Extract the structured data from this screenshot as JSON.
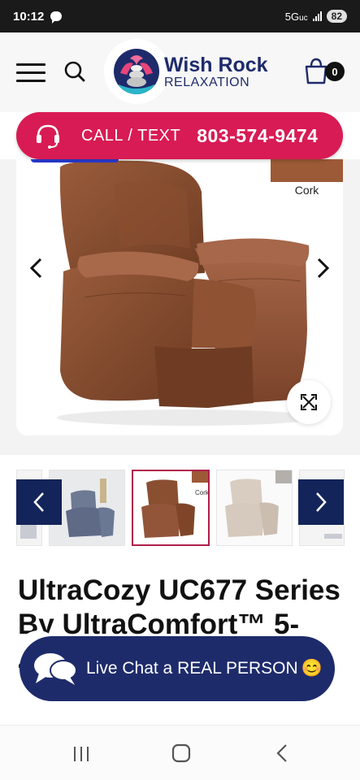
{
  "status_bar": {
    "time": "10:12",
    "network": "5G",
    "network_sub": "uc",
    "battery": "82"
  },
  "header": {
    "logo_line1": "Wish Rock",
    "logo_line2": "RELAXATION",
    "cart_count": "0"
  },
  "call_banner": {
    "label": "CALL / TEXT",
    "number": "803-574-9474"
  },
  "gallery": {
    "swatch_label": "Cork",
    "thumb_swatch_label": "Cork"
  },
  "product": {
    "title": "UltraCozy UC677 Series By UltraComfort™ 5-Zone Power Recliner"
  },
  "live_chat": {
    "label": "Live Chat a REAL PERSON",
    "emoji": "😊"
  },
  "colors": {
    "brand_navy": "#1e2b6b",
    "call_pink": "#d81b54",
    "leather_brown": "#8e5233"
  }
}
